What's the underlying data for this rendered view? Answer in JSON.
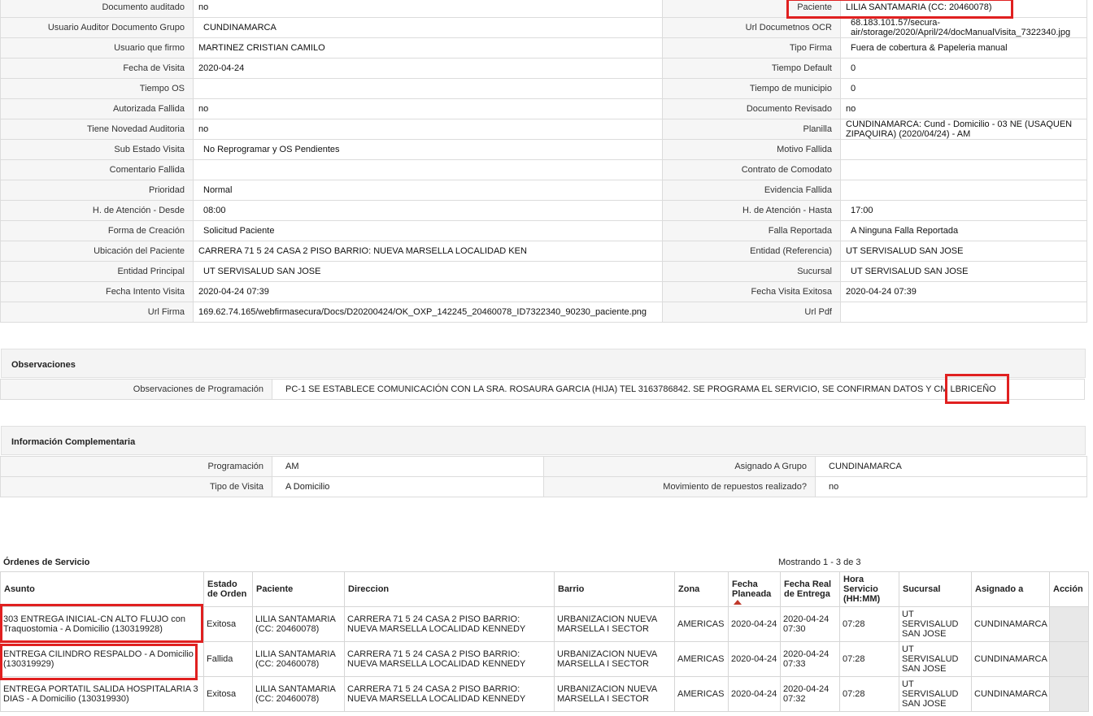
{
  "details": {
    "rows": [
      {
        "l1": "Documento auditado",
        "v1": "no",
        "l2": "Paciente",
        "v2": "LILIA SANTAMARIA (CC: 20460078)"
      },
      {
        "l1": "Usuario Auditor Documento Grupo",
        "v1": "CUNDINAMARCA",
        "l2": "Url Documetnos OCR",
        "v2": "68.183.101.57/secura-air/storage/2020/April/24/docManualVisita_7322340.jpg"
      },
      {
        "l1": "Usuario que firmo",
        "v1": "MARTINEZ CRISTIAN CAMILO",
        "l2": "Tipo Firma",
        "v2": "Fuera de cobertura & Papeleria manual"
      },
      {
        "l1": "Fecha de Visita",
        "v1": "2020-04-24",
        "l2": "Tiempo Default",
        "v2": "0"
      },
      {
        "l1": "Tiempo OS",
        "v1": "",
        "l2": "Tiempo de municipio",
        "v2": "0"
      },
      {
        "l1": "Autorizada Fallida",
        "v1": "no",
        "l2": "Documento Revisado",
        "v2": "no"
      },
      {
        "l1": "Tiene Novedad Auditoria",
        "v1": "no",
        "l2": "Planilla",
        "v2": "CUNDINAMARCA: Cund - Domicilio - 03 NE (USAQUEN ZIPAQUIRA) (2020/04/24) - AM"
      },
      {
        "l1": "Sub Estado Visita",
        "v1": "No Reprogramar y OS Pendientes",
        "l2": "Motivo Fallida",
        "v2": ""
      },
      {
        "l1": "Comentario Fallida",
        "v1": "",
        "l2": "Contrato de Comodato",
        "v2": ""
      },
      {
        "l1": "Prioridad",
        "v1": "Normal",
        "l2": "Evidencia Fallida",
        "v2": ""
      },
      {
        "l1": "H. de Atención - Desde",
        "v1": "08:00",
        "l2": "H. de Atención - Hasta",
        "v2": "17:00"
      },
      {
        "l1": "Forma de Creación",
        "v1": "Solicitud Paciente",
        "l2": "Falla Reportada",
        "v2": "A Ninguna Falla Reportada"
      },
      {
        "l1": "Ubicación del Paciente",
        "v1": "CARRERA 71 5 24 CASA 2 PISO BARRIO: NUEVA MARSELLA LOCALIDAD KEN",
        "l2": "Entidad (Referencia)",
        "v2": "UT SERVISALUD SAN JOSE"
      },
      {
        "l1": "Entidad Principal",
        "v1": "UT SERVISALUD SAN JOSE",
        "l2": "Sucursal",
        "v2": "UT SERVISALUD SAN JOSE"
      },
      {
        "l1": "Fecha Intento Visita",
        "v1": "2020-04-24 07:39",
        "l2": "Fecha Visita Exitosa",
        "v2": "2020-04-24 07:39"
      },
      {
        "l1": "Url Firma",
        "v1": "169.62.74.165/webfirmasecura/Docs/D20200424/OK_OXP_142245_20460078_ID7322340_90230_paciente.png",
        "l2": "Url Pdf",
        "v2": ""
      }
    ]
  },
  "observaciones": {
    "title": "Observaciones",
    "label": "Observaciones de Programación",
    "value": "PC-1 SE ESTABLECE COMUNICACIÓN CON LA SRA. ROSAURA GARCIA (HIJA) TEL 3163786842. SE PROGRAMA EL SERVICIO, SE CONFIRMAN DATOS Y CM LBRICEÑO"
  },
  "info": {
    "title": "Información Complementaria",
    "rows": [
      {
        "l1": "Programación",
        "v1": "AM",
        "l2": "Asignado A Grupo",
        "v2": "CUNDINAMARCA"
      },
      {
        "l1": "Tipo de Visita",
        "v1": "A Domicilio",
        "l2": "Movimiento de repuestos realizado?",
        "v2": "no"
      }
    ]
  },
  "orders": {
    "title": "Órdenes de Servicio",
    "count": "Mostrando 1 - 3 de 3",
    "headers": [
      "Asunto",
      "Estado de Orden",
      "Paciente",
      "Direccion",
      "Barrio",
      "Zona",
      "Fecha Planeada",
      "Fecha Real de Entrega",
      "Hora Servicio (HH:MM)",
      "Sucursal",
      "Asignado a",
      "Acción"
    ],
    "rows": [
      {
        "asunto": "303 ENTREGA INICIAL-CN ALTO FLUJO con Traquostomia - A Domicilio (130319928)",
        "estado": "Exitosa",
        "paciente": "LILIA SANTAMARIA (CC: 20460078)",
        "direccion": "CARRERA 71 5 24 CASA 2 PISO BARRIO: NUEVA MARSELLA LOCALIDAD KENNEDY",
        "barrio": "URBANIZACION NUEVA MARSELLA I SECTOR",
        "zona": "AMERICAS",
        "fecha_planeada": "2020-04-24",
        "fecha_real": "2020-04-24 07:30",
        "hora": "07:28",
        "sucursal": "UT SERVISALUD SAN JOSE",
        "asignado": "CUNDINAMARCA"
      },
      {
        "asunto": "ENTREGA CILINDRO RESPALDO - A Domicilio (130319929)",
        "estado": "Fallida",
        "paciente": "LILIA SANTAMARIA (CC: 20460078)",
        "direccion": "CARRERA 71 5 24 CASA 2 PISO BARRIO: NUEVA MARSELLA LOCALIDAD KENNEDY",
        "barrio": "URBANIZACION NUEVA MARSELLA I SECTOR",
        "zona": "AMERICAS",
        "fecha_planeada": "2020-04-24",
        "fecha_real": "2020-04-24 07:33",
        "hora": "07:28",
        "sucursal": "UT SERVISALUD SAN JOSE",
        "asignado": "CUNDINAMARCA"
      },
      {
        "asunto": "ENTREGA PORTATIL SALIDA HOSPITALARIA 3 DIAS - A Domicilio (130319930)",
        "estado": "Exitosa",
        "paciente": "LILIA SANTAMARIA (CC: 20460078)",
        "direccion": "CARRERA 71 5 24 CASA 2 PISO BARRIO: NUEVA MARSELLA LOCALIDAD KENNEDY",
        "barrio": "URBANIZACION NUEVA MARSELLA I SECTOR",
        "zona": "AMERICAS",
        "fecha_planeada": "2020-04-24",
        "fecha_real": "2020-04-24 07:32",
        "hora": "07:28",
        "sucursal": "UT SERVISALUD SAN JOSE",
        "asignado": "CUNDINAMARCA"
      }
    ]
  }
}
